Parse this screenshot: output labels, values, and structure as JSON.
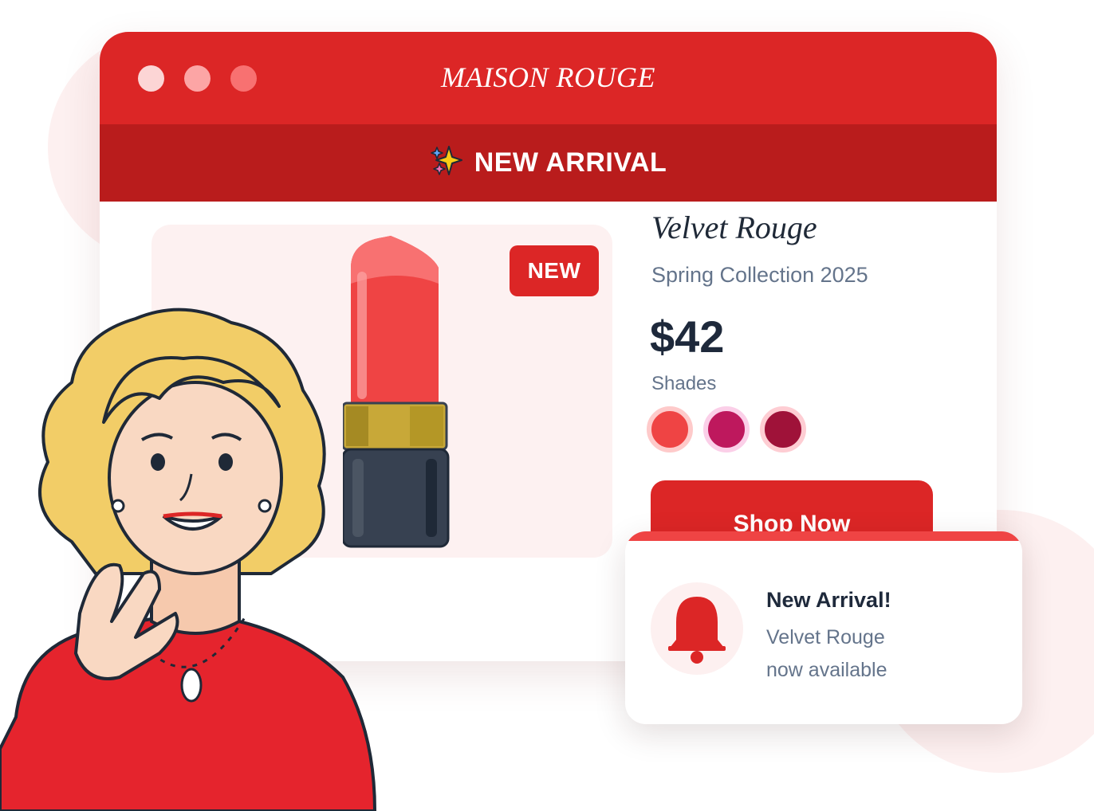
{
  "window": {
    "title": "MAISON ROUGE",
    "controls": [
      {
        "name": "close",
        "color": "#fcd5d5"
      },
      {
        "name": "minimize",
        "color": "#fca5a5"
      },
      {
        "name": "maximize",
        "color": "#f87171"
      }
    ]
  },
  "banner": {
    "icon": "sparkles-icon",
    "text": "NEW ARRIVAL"
  },
  "product": {
    "badge": "NEW",
    "name": "Velvet Rouge",
    "collection": "Spring Collection 2025",
    "price": "$42",
    "shades_label": "Shades",
    "shades": [
      {
        "color": "#ef4444",
        "ring": "#fecaca"
      },
      {
        "color": "#be185d",
        "ring": "#fbcfe8"
      },
      {
        "color": "#9f1239",
        "ring": "#fecdd3"
      }
    ],
    "cta": "Shop Now"
  },
  "notification": {
    "icon": "bell-icon",
    "title": "New Arrival!",
    "line1": "Velvet Rouge",
    "line2": "now available"
  },
  "colors": {
    "brand": "#dc2626",
    "banner": "#b91c1c",
    "accent": "#ef4444"
  }
}
